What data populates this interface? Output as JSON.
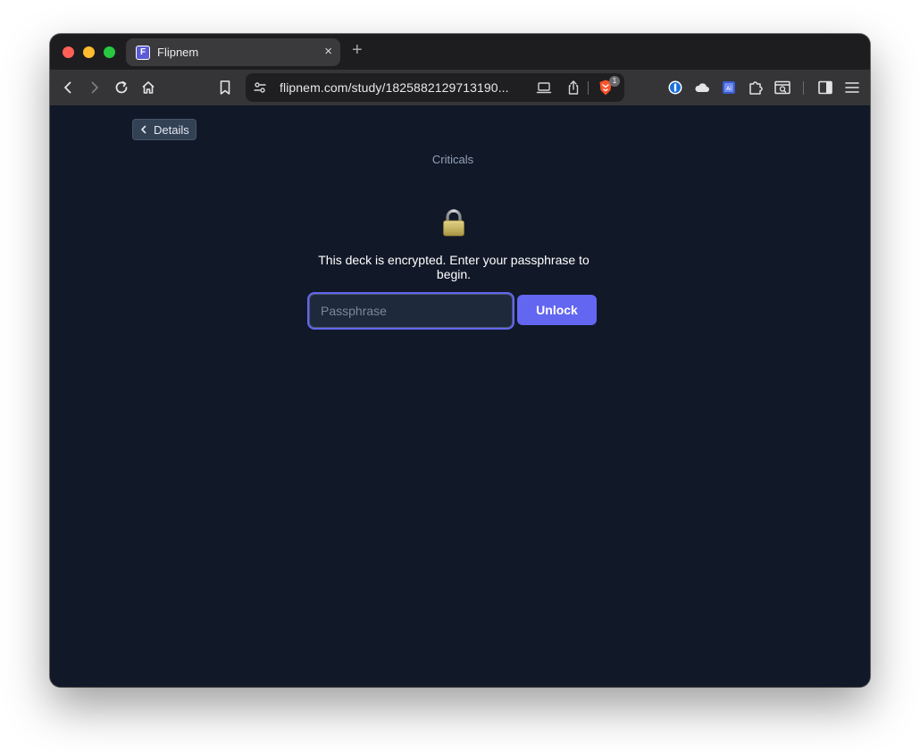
{
  "browser": {
    "tab": {
      "favicon_letter": "F",
      "title": "Flipnem",
      "close_glyph": "×"
    },
    "new_tab_glyph": "+",
    "url": "flipnem.com/study/1825882129713190...",
    "brave_shields_count": "1",
    "toolbar_icons": [
      "back-icon",
      "forward-icon",
      "reload-icon",
      "home-icon",
      "bookmark-icon",
      "site-settings-icon",
      "cast-icon",
      "share-icon",
      "brave-shields-icon",
      "1password-icon",
      "cloud-icon",
      "translate-icon",
      "extensions-icon",
      "screenshot-icon",
      "sidebar-icon",
      "menu-icon"
    ]
  },
  "page": {
    "back_button_label": "Details",
    "deck_title": "Criticals",
    "lock_icon": "lock-icon",
    "message": "This deck is encrypted. Enter your passphrase to begin.",
    "passphrase_placeholder": "Passphrase",
    "passphrase_value": "",
    "unlock_label": "Unlock"
  },
  "colors": {
    "page_background": "#111827",
    "accent": "#6366f1",
    "input_background": "#1e293b",
    "muted_text": "#94a3b8"
  }
}
